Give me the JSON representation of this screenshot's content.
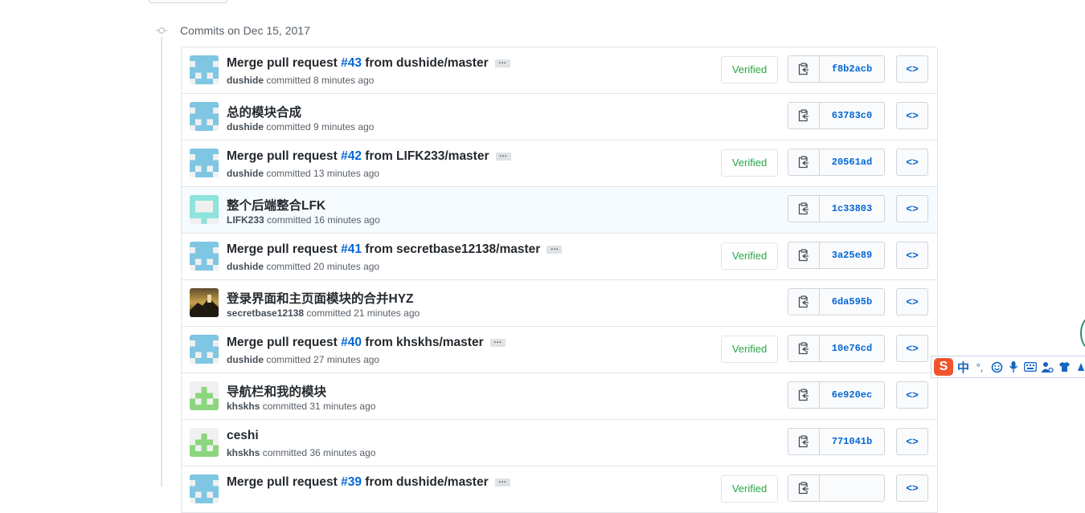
{
  "date_heading": "Commits on Dec 15, 2017",
  "verified_label": "Verified",
  "ellipsis_label": "…",
  "browse_label": "<>",
  "ime": {
    "logo": "S",
    "lang": "中",
    "punct": "°,"
  },
  "commits": [
    {
      "title_pre": "Merge pull request ",
      "pr": "#43",
      "title_post": " from dushide/master",
      "ellipsis": true,
      "author": "dushide",
      "time": " committed 8 minutes ago",
      "verified": true,
      "sha": "f8b2acb",
      "avatar": "blue"
    },
    {
      "title_pre": "总的模块合成",
      "pr": "",
      "title_post": "",
      "ellipsis": false,
      "author": "dushide",
      "time": " committed 9 minutes ago",
      "verified": false,
      "sha": "63783c0",
      "avatar": "blue"
    },
    {
      "title_pre": "Merge pull request ",
      "pr": "#42",
      "title_post": " from LIFK233/master",
      "ellipsis": true,
      "author": "dushide",
      "time": " committed 13 minutes ago",
      "verified": true,
      "sha": "20561ad",
      "avatar": "blue"
    },
    {
      "title_pre": "整个后端整合LFK",
      "pr": "",
      "title_post": "",
      "ellipsis": false,
      "author": "LIFK233",
      "time": " committed 16 minutes ago",
      "verified": false,
      "sha": "1c33803",
      "avatar": "teal",
      "hover": true
    },
    {
      "title_pre": "Merge pull request ",
      "pr": "#41",
      "title_post": " from secretbase12138/master",
      "ellipsis": true,
      "author": "dushide",
      "time": " committed 20 minutes ago",
      "verified": true,
      "sha": "3a25e89",
      "avatar": "blue"
    },
    {
      "title_pre": "登录界面和主页面模块的合并HYZ",
      "pr": "",
      "title_post": "",
      "ellipsis": false,
      "author": "secretbase12138",
      "time": " committed 21 minutes ago",
      "verified": false,
      "sha": "6da595b",
      "avatar": "photo"
    },
    {
      "title_pre": "Merge pull request ",
      "pr": "#40",
      "title_post": " from khskhs/master",
      "ellipsis": true,
      "author": "dushide",
      "time": " committed 27 minutes ago",
      "verified": true,
      "sha": "10e76cd",
      "avatar": "blue"
    },
    {
      "title_pre": "导航栏和我的模块",
      "pr": "",
      "title_post": "",
      "ellipsis": false,
      "author": "khskhs",
      "time": " committed 31 minutes ago",
      "verified": false,
      "sha": "6e920ec",
      "avatar": "green"
    },
    {
      "title_pre": "ceshi",
      "pr": "",
      "title_post": "",
      "ellipsis": false,
      "author": "khskhs",
      "time": " committed 36 minutes ago",
      "verified": false,
      "sha": "771041b",
      "avatar": "green"
    },
    {
      "title_pre": "Merge pull request ",
      "pr": "#39",
      "title_post": " from dushide/master",
      "ellipsis": true,
      "author": "",
      "time": "",
      "verified": true,
      "sha": "",
      "avatar": "blue"
    }
  ]
}
